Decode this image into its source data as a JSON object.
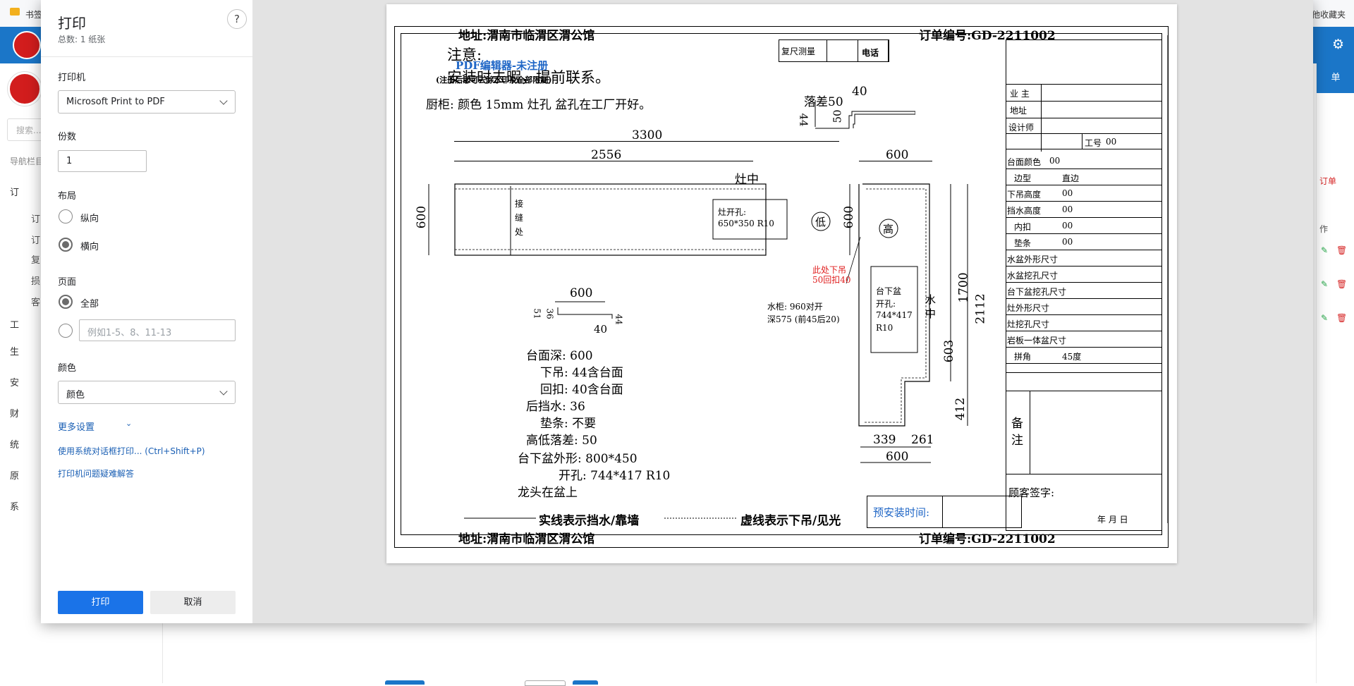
{
  "bg": {
    "bookmark_folder": "书签",
    "bookmark_right": "他收藏夹",
    "side_search": "搜索...",
    "side_caption": "导航栏目",
    "side_items": [
      "订",
      "工",
      "生",
      "安",
      "财",
      "统",
      "原",
      "系"
    ],
    "side_subs": [
      "订",
      "订",
      "复",
      "损",
      "客"
    ],
    "right_tab": "单",
    "right_texts": [
      "订单",
      "作"
    ]
  },
  "dialog": {
    "title": "打印",
    "total": "总数: 1 纸张",
    "help": "?",
    "printer_label": "打印机",
    "printer_value": "Microsoft Print to PDF",
    "copies_label": "份数",
    "copies_value": "1",
    "layout_label": "布局",
    "layout_portrait": "纵向",
    "layout_landscape": "横向",
    "pages_label": "页面",
    "pages_all": "全部",
    "pages_placeholder": "例如1-5、8、11-13",
    "color_label": "颜色",
    "color_value": "颜色",
    "more_settings": "更多设置",
    "system_dialog": "使用系统对话框打印... (Ctrl+Shift+P)",
    "troubleshoot": "打印机问题疑难解答",
    "print_btn": "打印",
    "cancel_btn": "取消"
  },
  "doc": {
    "address": "地址:渭南市临渭区渭公馆",
    "order_no": "订单编号:GD-2211002",
    "note_title": "注意:",
    "note_line": "安装时去暇，提前联系。",
    "watermark": "PDF编辑器-未注册",
    "watermark_sub": "(注册后即可去除水印及全部限制)",
    "cabinet_line": "厨柜: 颜色   15mm     灶孔 盆孔在工厂开好。",
    "measure_label": "复尺测量",
    "phone_label": "电话",
    "drop_label": "落差50",
    "dims": {
      "d3300": "3300",
      "d2556": "2556",
      "d600_top": "600",
      "d600_left": "600",
      "d600_right": "600",
      "d40_top": "40",
      "d44_top": "44",
      "d50_top": "50",
      "d600_mid": "600",
      "d51": "51",
      "d36": "36",
      "d44_mid": "44",
      "d40_mid": "40",
      "d1700": "1700",
      "d2112": "2112",
      "d603": "603",
      "d412": "412",
      "d339": "339",
      "d261": "261",
      "d600_bottom": "600"
    },
    "zaozhong_top": "灶中",
    "joint_label": [
      "接",
      "缝",
      "处"
    ],
    "cooktop_hole": "灶开孔:",
    "cooktop_size": "650*350 R10",
    "low_mark": "低",
    "high_mark": "高",
    "undercounter_title": "台下盆",
    "undercounter_hole": "开孔:",
    "undercounter_size": "744*417",
    "undercounter_r": "R10",
    "red_note1": "此处下吊",
    "red_note2": "50回扣40",
    "water_cabinet1": "水柜: 960对开",
    "water_cabinet2": "深575 (前45后20)",
    "sink_center": [
      "水",
      "中"
    ],
    "specs": [
      "台面深: 600",
      "下吊: 44含台面",
      "回扣: 40含台面",
      "后挡水: 36",
      "垫条: 不要",
      "高低落差: 50",
      "台下盆外形: 800*450",
      "开孔: 744*417 R10",
      "龙头在盆上"
    ],
    "legend_solid": "实线表示挡水/靠墙",
    "legend_dashed": "虚线表示下吊/见光",
    "preinstall": "预安装时间:",
    "right_table": {
      "owner": "业 主",
      "address": "地址",
      "designer": "设计师",
      "work_no_label": "工号",
      "work_no": "00",
      "rows": [
        {
          "label": "台面颜色",
          "value": "00"
        },
        {
          "label": "边型",
          "value": "直边"
        },
        {
          "label": "下吊高度",
          "value": "00"
        },
        {
          "label": "挡水高度",
          "value": "00"
        },
        {
          "label": "内扣",
          "value": "00"
        },
        {
          "label": "垫条",
          "value": "00"
        },
        {
          "label": "水盆外形尺寸",
          "value": ""
        },
        {
          "label": "水盆挖孔尺寸",
          "value": ""
        },
        {
          "label": "台下盆挖孔尺寸",
          "value": ""
        },
        {
          "label": "灶外形尺寸",
          "value": ""
        },
        {
          "label": "灶挖孔尺寸",
          "value": ""
        },
        {
          "label": "岩板一体盆尺寸",
          "value": ""
        },
        {
          "label": "拼角",
          "value": "45度"
        }
      ],
      "remarks": [
        "备",
        "注"
      ],
      "signature": "顾客签字:",
      "date": "年   月   日"
    }
  }
}
